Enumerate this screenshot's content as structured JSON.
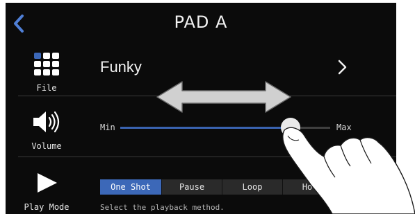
{
  "header": {
    "title": "PAD A",
    "back_icon": "chevron-left-icon"
  },
  "file": {
    "label": "File",
    "icon": "grid-icon",
    "value": "Funky",
    "next_icon": "chevron-right-icon"
  },
  "volume": {
    "label": "Volume",
    "icon": "speaker-icon",
    "min_label": "Min",
    "max_label": "Max",
    "level": 0.81
  },
  "play_mode": {
    "label": "Play Mode",
    "icon": "play-icon",
    "options": [
      "One Shot",
      "Pause",
      "Loop",
      "Ho"
    ],
    "selected": "One Shot",
    "hint": "Select the playback method."
  },
  "colors": {
    "accent": "#3c68b8",
    "background": "#0b0b0b"
  }
}
